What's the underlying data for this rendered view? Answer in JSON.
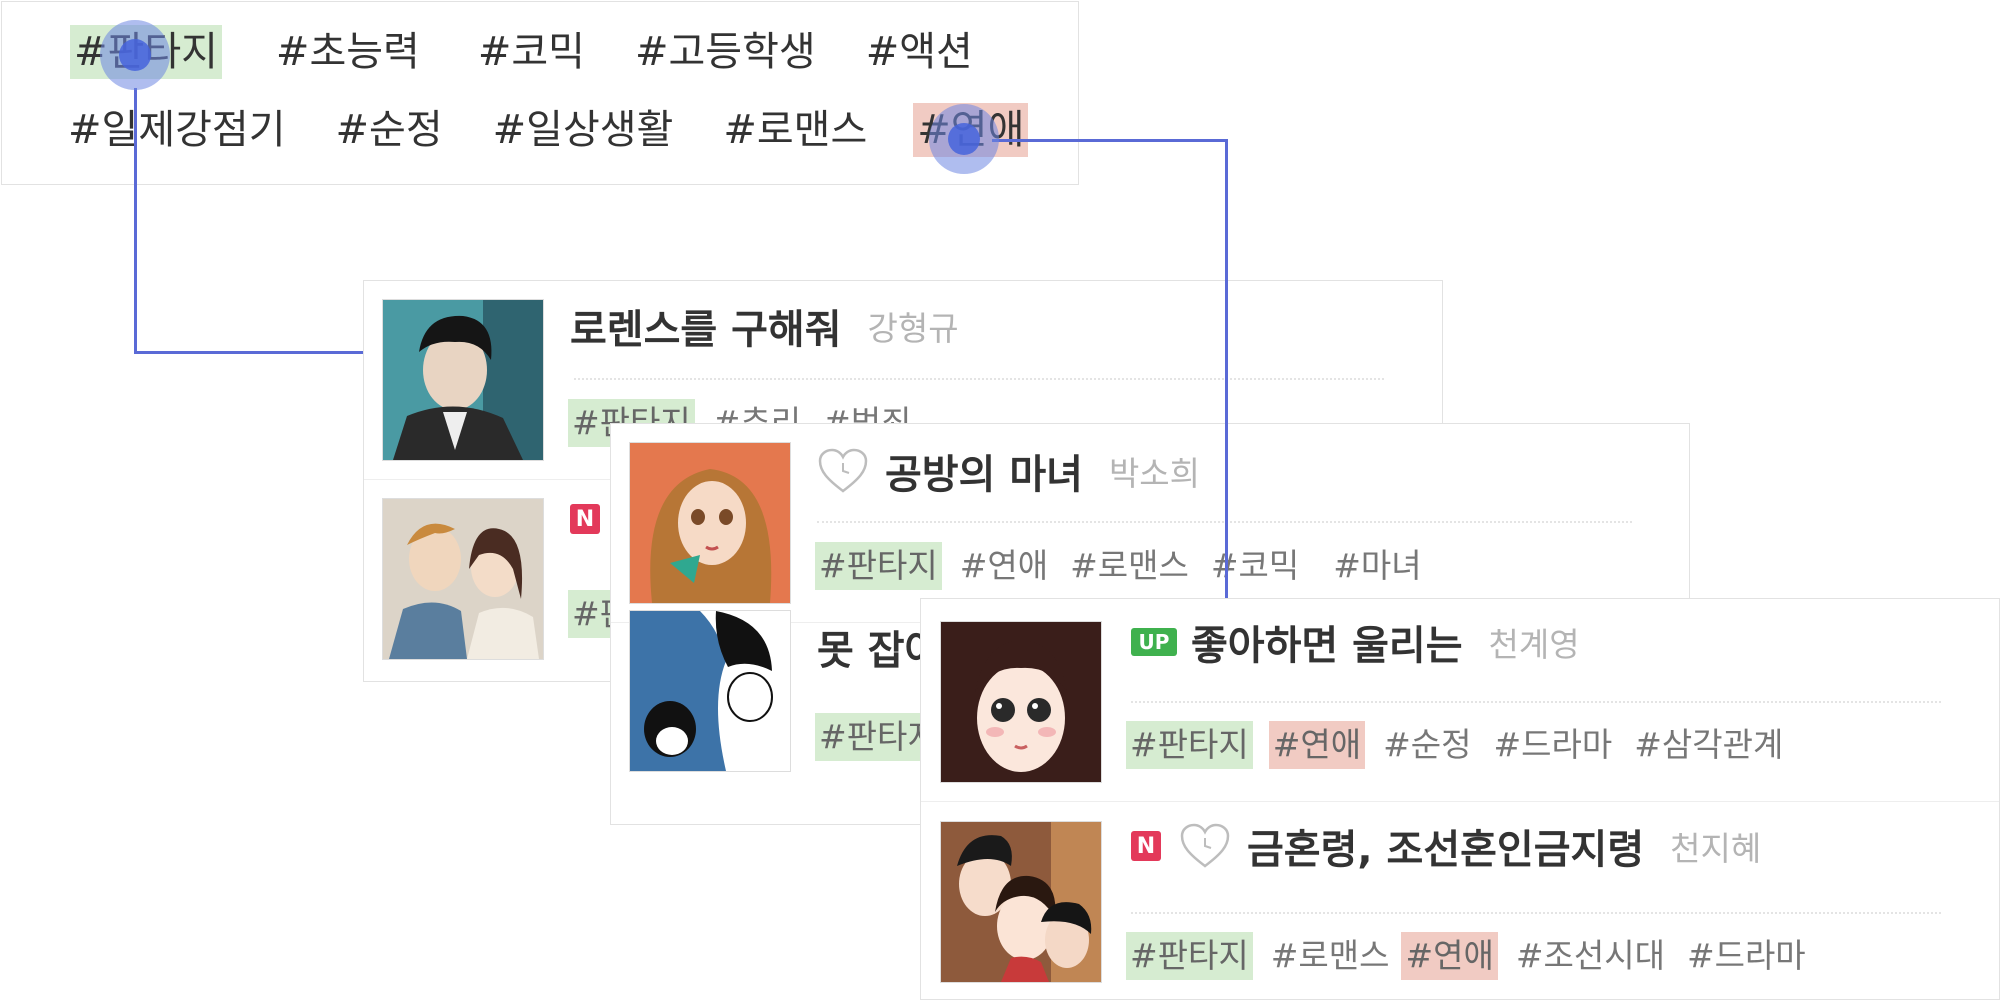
{
  "tag_panel": {
    "row1": [
      "#판타지",
      "#초능력",
      "#코믹",
      "#고등학생",
      "#액션"
    ],
    "row2": [
      "#일제강점기",
      "#순정",
      "#일상생활",
      "#로맨스",
      "#연애"
    ]
  },
  "list1": {
    "item1": {
      "title": "로렌스를 구해줘",
      "author": "강형규",
      "tags": [
        "#판타지",
        "#추리",
        "#범죄"
      ]
    },
    "item2": {
      "badge": "N",
      "tags": [
        "#판타지"
      ]
    }
  },
  "list2": {
    "item1": {
      "title": "공방의 마녀",
      "author": "박소희",
      "tags": [
        "#판타지",
        "#연애",
        "#로맨스",
        "#코믹",
        "#마녀"
      ]
    },
    "item2": {
      "title": "못 잡아",
      "tags": [
        "#판타지"
      ]
    }
  },
  "list3": {
    "item1": {
      "badge": "UP",
      "title": "좋아하면 울리는",
      "author": "천계영",
      "tags": [
        "#판타지",
        "#연애",
        "#순정",
        "#드라마",
        "#삼각관계"
      ]
    },
    "item2": {
      "badge": "N",
      "title": "금혼령, 조선혼인금지령",
      "author": "천지혜",
      "tags": [
        "#판타지",
        "#로맨스",
        "#연애",
        "#조선시대",
        "#드라마"
      ]
    }
  },
  "colors": {
    "fantasy_highlight": "#d6ecd1",
    "romance_highlight": "#f1cbc3",
    "connector": "#5a6ad6",
    "badge_new": "#e3395a",
    "badge_up": "#3fb14e"
  }
}
